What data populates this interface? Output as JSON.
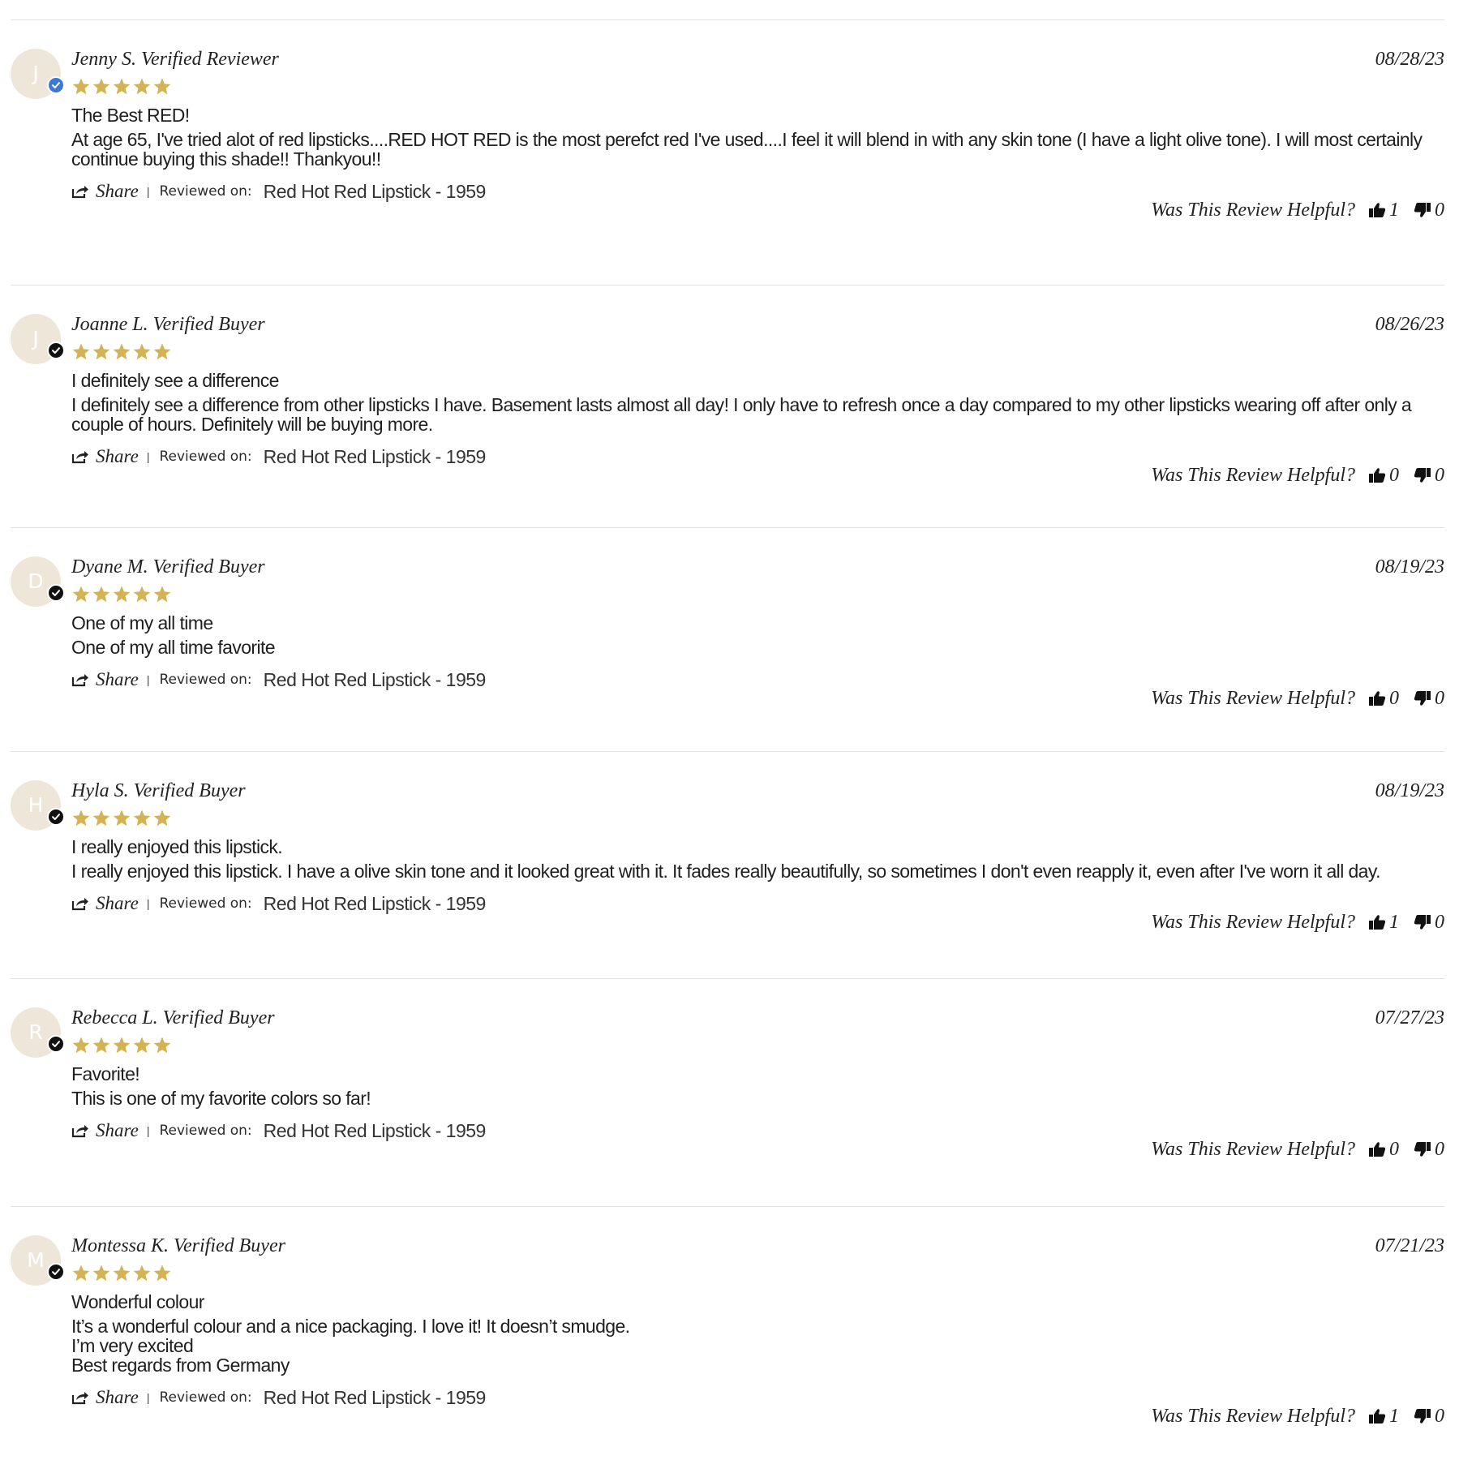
{
  "helpful_label": "Was This Review Helpful?",
  "share_label": "Share",
  "reviewed_on_label": "Reviewed on:",
  "separator": "|",
  "colors": {
    "star": "#d4b354",
    "avatar_bg": "#efe6da",
    "badge_black": "#111111",
    "badge_blue": "#3c79d6",
    "divider": "#e2e2e2"
  },
  "icons": {
    "star": "star-icon",
    "badge": "check-badge-icon",
    "share": "share-icon",
    "thumbs_up": "thumbs-up-icon",
    "thumbs_down": "thumbs-down-icon"
  },
  "reviews": [
    {
      "initial": "J",
      "name": "Jenny S. Verified Reviewer",
      "badge": "blue",
      "date": "08/28/23",
      "rating": 5,
      "title": "The Best RED!",
      "body": "At age 65, I've tried alot of red lipsticks....RED HOT RED is the most perefct red I've used....I feel it will blend in with any skin tone (I have a light olive tone). I will most certainly continue buying this shade!! Thankyou!!",
      "product": "Red Hot Red Lipstick - 1959",
      "helpful_up": "1",
      "helpful_down": "0"
    },
    {
      "initial": "J",
      "name": "Joanne L. Verified Buyer",
      "badge": "black",
      "date": "08/26/23",
      "rating": 5,
      "title": "I definitely see a difference",
      "body": "I definitely see a difference from other lipsticks I have. Basement lasts almost all day! I only have to refresh once a day compared to my other lipsticks wearing off after only a couple of hours. Definitely will be buying more.",
      "product": "Red Hot Red Lipstick - 1959",
      "helpful_up": "0",
      "helpful_down": "0"
    },
    {
      "initial": "D",
      "name": "Dyane M. Verified Buyer",
      "badge": "black",
      "date": "08/19/23",
      "rating": 5,
      "title": "One of my all time",
      "body": "One of my all time favorite",
      "product": "Red Hot Red Lipstick - 1959",
      "helpful_up": "0",
      "helpful_down": "0"
    },
    {
      "initial": "H",
      "name": "Hyla S. Verified Buyer",
      "badge": "black",
      "date": "08/19/23",
      "rating": 5,
      "title": "I really enjoyed this lipstick.",
      "body": "I really enjoyed this lipstick. I have a olive skin tone and it looked great with it. It fades really beautifully, so sometimes I don't even reapply it, even after I've worn it all day.",
      "product": "Red Hot Red Lipstick - 1959",
      "helpful_up": "1",
      "helpful_down": "0"
    },
    {
      "initial": "R",
      "name": "Rebecca L. Verified Buyer",
      "badge": "black",
      "date": "07/27/23",
      "rating": 5,
      "title": "Favorite!",
      "body": "This is one of my favorite colors so far!",
      "product": "Red Hot Red Lipstick - 1959",
      "helpful_up": "0",
      "helpful_down": "0"
    },
    {
      "initial": "M",
      "name": "Montessa K. Verified Buyer",
      "badge": "black",
      "date": "07/21/23",
      "rating": 5,
      "title": "Wonderful colour",
      "body": "It’s a wonderful colour and a nice packaging. I love it! It doesn’t smudge.\nI’m very excited\nBest regards from Germany",
      "product": "Red Hot Red Lipstick - 1959",
      "helpful_up": "1",
      "helpful_down": "0"
    }
  ]
}
